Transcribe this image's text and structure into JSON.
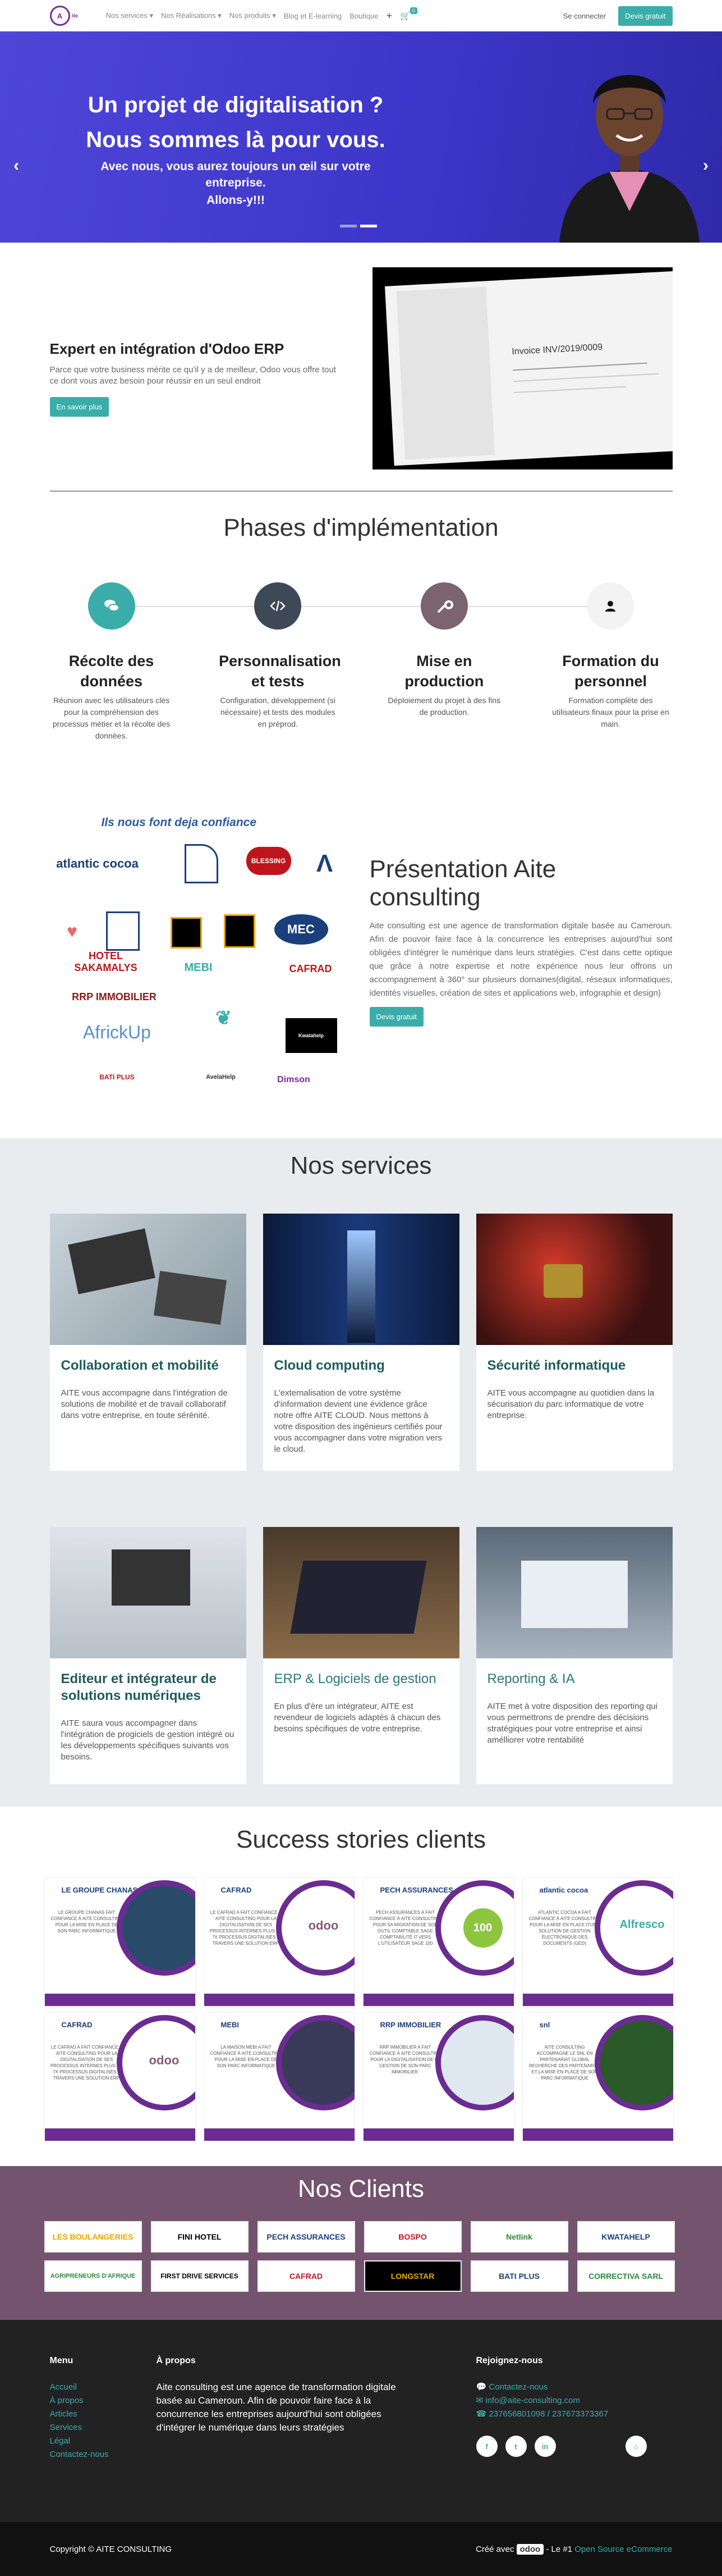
{
  "header": {
    "logo_letter": "A",
    "logo_text": "ite",
    "nav": [
      "Nos services",
      "Nos Réalisations",
      "Nos produits",
      "Blog et E-learning",
      "Boutique"
    ],
    "plus": "+",
    "cart_count": "0",
    "signin": "Se connecter",
    "trial": "Devis gratuit"
  },
  "hero": {
    "title_line1": "Un projet de digitalisation ?",
    "title_line2": "Nous sommes là pour vous.",
    "subtitle_line1": "Avec nous, vous aurez toujours un œil sur votre entreprise.",
    "subtitle_line2": "Allons-y!!!",
    "prev": "‹",
    "next": "›"
  },
  "erp": {
    "title": "Expert en intégration d'Odoo ERP",
    "text": "Parce que votre business mérite ce qu'il y a de meilleur, Odoo vous offre tout ce dont vous avez besoin pour réussir en un seul endroit",
    "button": "En savoir plus",
    "invoice_label": "Invoice INV/2019/0009"
  },
  "phases": {
    "title": "Phases d'implémentation",
    "items": [
      {
        "title": "Récolte des données",
        "text": "Réunion avec les utilisateurs clés pour la compréhension des processus métier et la récolte des données.",
        "color": "#3aadaa",
        "icon": "chat-icon"
      },
      {
        "title": "Personnalisation et tests",
        "text": "Configuration, développement (si nécessaire) et tests des modules en préprod.",
        "color": "#3d4957",
        "icon": "code-icon"
      },
      {
        "title": "Mise en production",
        "text": "Déploiement du projet à des fins de production.",
        "color": "#7b6370",
        "icon": "wrench-icon"
      },
      {
        "title": "Formation du personnel",
        "text": "Formation complète des utilisateurs finaux pour la prise en main.",
        "color": "#f3f3f3",
        "icon": "user-icon"
      }
    ]
  },
  "presentation": {
    "logos_heading": "Ils nous font deja confiance",
    "title": "Présentation Aite consulting",
    "text": "Aite consulting est une agence de transformation digitale basée au Cameroun. Afin de pouvoir faire face à la concurrence les entreprises aujourd'hui sont obligées d'intégrer le numérique dans leurs stratégies. C'est dans cette optique que grâce à notre expertise et notre expérience nous leur offrons un accompagnement à 360° sur plusieurs domaines(digital, réseaux informatiques, identités visuelles, création de sites et applications web, infographie et design)",
    "button": "Devis gratuit",
    "client_logos": [
      "atlantic cocoa",
      "BLESSING",
      "HOTEL SAKAMALYS",
      "MEBI",
      "CAFRAD",
      "RRP IMMOBILIER",
      "AfrickUp",
      "BATI PLUS",
      "MEC",
      "AvelaHelp",
      "Dimson",
      "Kwatahelp"
    ]
  },
  "services": {
    "title": "Nos services",
    "items": [
      {
        "title": "Collaboration et mobilité",
        "text": "AITE vous accompagne dans l'intégration de solutions de mobilité et de travail collaboratif dans votre entreprise, en toute sérénité.",
        "style": "bold"
      },
      {
        "title": "Cloud computing",
        "text": "L'externalisation de votre système d'information devient une évidence grâce notre offre AITE CLOUD. Nous mettons à votre disposition des ingénieurs certifiés pour vous accompagner dans votre migration vers le cloud.",
        "style": "bold"
      },
      {
        "title": "Sécurité informatique",
        "text": "AITE vous accompagne au quotidien dans la sécurisation du parc informatique de votre entreprise.",
        "style": "bold"
      },
      {
        "title": "Editeur et intégrateur de solutions numériques",
        "text": "AITE saura vous accompagner dans l'intégration de progiciels de gestion intégré ou les développements spécifiques suivants vos besoins.",
        "style": "bold"
      },
      {
        "title": "ERP & Logiciels de gestion",
        "text": "En plus d'ère un intégrateur, AITE est revendeur de logiciels adaptés à chacun des besoins spécifiques de votre entreprise.",
        "style": "light"
      },
      {
        "title": "Reporting & IA",
        "text": "AITE met à votre disposition des reporting qui vous permettrons de prendre des décisions stratégiques pour votre entreprise et ainsi amélliorer votre rentabilité",
        "style": "light"
      }
    ]
  },
  "success": {
    "title": "Success stories clients",
    "stories": [
      {
        "logo": "LE GROUPE CHANAS",
        "text": "LE GROUPE CHANAS FAIT CONFIANCE À AITE CONSULTING POUR LA MISE EN PLACE DE SON PARC INFORMATIQUE"
      },
      {
        "logo": "CAFRAD",
        "text": "LE CAFRAD A FAIT CONFIANCE À AITE CONSULTING POUR LA DIGITALISATION DE SES PROCESSUS INTERNES PLUS DE 7X PROCESSUS DIGITALISÉS À TRAVERS UNE SOLUTION ERP."
      },
      {
        "logo": "PECH ASSURANCES",
        "text": "PECH ASSURANCES A FAIT CONFIANCE À AITE CONSULTING POUR SA MIGRATION DE SON OUTIL COMPTABLE SAGE COMPTABILITÉ I7 VERS L'UTILISATEUR SAGE 100"
      },
      {
        "logo": "atlantic cocoa",
        "text": "ATLANTIC COCOA A FAIT CONFIANCE À AITE CONSULTING POUR LA MISE EN PLACE D'UNE SOLUTION DE GESTION ÉLECTRONIQUE DES DOCUMENTS (GED)"
      },
      {
        "logo": "CAFRAD",
        "text": "LE CAFRAD A FAIT CONFIANCE À AITE CONSULTING POUR LA DIGITALISATION DE SES PROCESSUS INTERNES PLUS DE 7X PROCESSUS DIGITALISÉS À TRAVERS UNE SOLUTION ERP."
      },
      {
        "logo": "MEBI",
        "text": "LA MAISON MEBI A FAIT CONFIANCE À AITE CONSULTING POUR LA MISE EN PLACE DE SON PARC INFORMATIQUE"
      },
      {
        "logo": "RRP IMMOBILIER",
        "text": "RRP IMMOBILIER A FAIT CONFIANCE À AITE CONSULTING POUR LA DIGITALISATION DE LA GESTION DE SON PARC IMMOBILIER."
      },
      {
        "logo": "snl",
        "text": "AITE CONSULTING ACCOMPAGNE LE SNL EN PARTENARIAT GLOBAL RECHERCHE DES PARTENAIRES ET LA MISE EN PLACE DE SON PARC INFORMATIQUE"
      }
    ]
  },
  "clients": {
    "title": "Nos Clients",
    "items": [
      "LES BOULANGERIES",
      "FINI HOTEL",
      "PECH ASSURANCES",
      "BOSPO",
      "Netlink",
      "KWATAHELP",
      "AGRIPRENEURS D'AFRIQUE",
      "FIRST DRIVE SERVICES",
      "CAFRAD",
      "LONGSTAR",
      "BATI PLUS",
      "CORRECTIVA SARL"
    ]
  },
  "footer": {
    "menu_title": "Menu",
    "menu": [
      "Accueil",
      "À propos",
      "Articles",
      "Services",
      "Légal",
      "Contactez-nous"
    ],
    "about_title": "À propos",
    "about": "Aite consulting est une agence de transformation digitale basée au Cameroun. Afin de pouvoir faire face à la concurrence les entreprises aujourd'hui sont obligées d'intégrer le numérique dans leurs stratégies",
    "contact_title": "Rejoignez-nous",
    "contact": [
      "Contactez-nous",
      "info@aite-consulting.com",
      "237656801098 / 237673373367"
    ],
    "socials": [
      "f",
      "t",
      "in",
      "⌂"
    ],
    "copyright": "Copyright © AITE CONSULTING",
    "created_with": "Créé avec",
    "odoo": "odoo",
    "number_one": "- Le #1",
    "ecommerce": "Open Source eCommerce"
  },
  "colors": {
    "teal": "#3aadaa",
    "hero": "#4f46d8",
    "clients_bg": "#74536f",
    "footer_bg": "#222222"
  }
}
